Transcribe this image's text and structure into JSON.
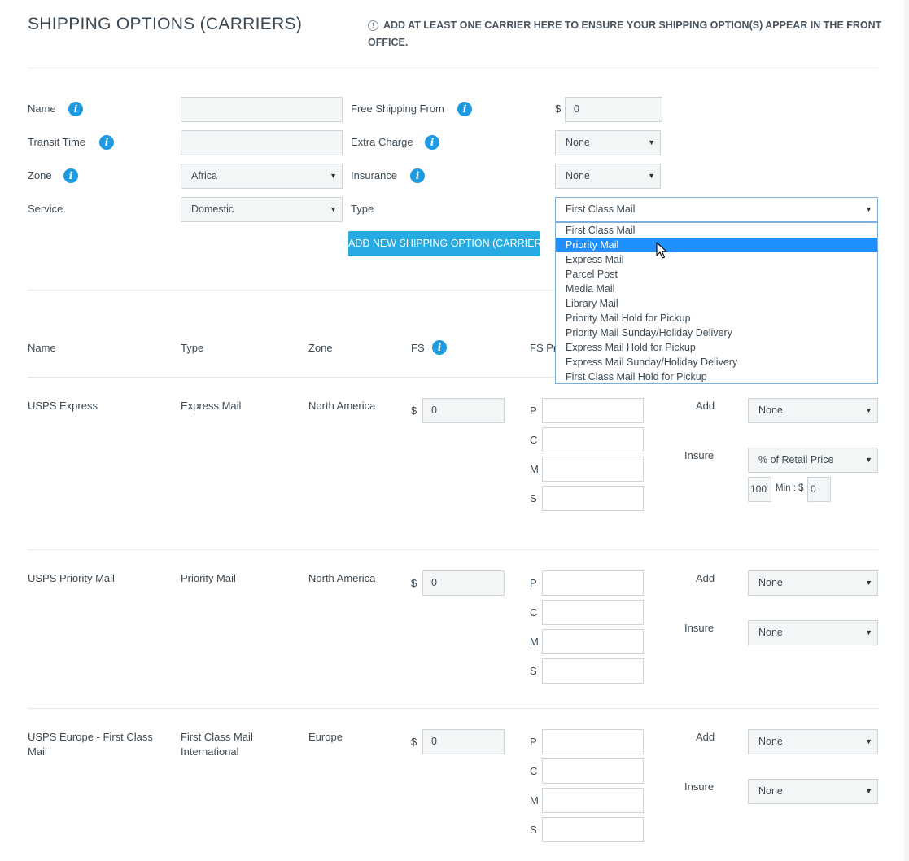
{
  "header": {
    "title": "SHIPPING OPTIONS (CARRIERS)",
    "notice_icon": "!",
    "notice": "ADD AT LEAST ONE CARRIER HERE TO ENSURE YOUR SHIPPING OPTION(S) APPEAR IN THE FRONT OFFICE."
  },
  "form": {
    "name_label": "Name",
    "transit_label": "Transit Time",
    "zone_label": "Zone",
    "zone_value": "Africa",
    "service_label": "Service",
    "service_value": "Domestic",
    "free_shipping_label": "Free Shipping From",
    "currency": "$",
    "free_shipping_value": "0",
    "extra_charge_label": "Extra Charge",
    "extra_charge_value": "None",
    "insurance_label": "Insurance",
    "insurance_value": "None",
    "type_label": "Type",
    "type_value": "First Class Mail",
    "add_button": "ADD NEW SHIPPING OPTION (CARRIER)",
    "info_glyph": "i",
    "arrow_glyph": "▼"
  },
  "type_dropdown": {
    "options": [
      "First Class Mail",
      "Priority Mail",
      "Express Mail",
      "Parcel Post",
      "Media Mail",
      "Library Mail",
      "Priority Mail Hold for Pickup",
      "Priority Mail Sunday/Holiday Delivery",
      "Express Mail Hold for Pickup",
      "Express Mail Sunday/Holiday Delivery",
      "First Class Mail Hold for Pickup"
    ],
    "highlighted": "Priority Mail"
  },
  "table": {
    "headers": {
      "name": "Name",
      "type": "Type",
      "zone": "Zone",
      "fs": "FS",
      "fs_price": "FS Pr"
    },
    "letters": {
      "p": "P",
      "c": "C",
      "m": "M",
      "s": "S"
    },
    "add_label": "Add",
    "insure_label": "Insure",
    "rows": [
      {
        "name": "USPS Express",
        "type": "Express Mail",
        "zone": "North America",
        "fs_value": "0",
        "add_value": "None",
        "insure_value": "% of Retail Price",
        "insure_percent": "100",
        "min_label": "Min : $",
        "min_value": "0"
      },
      {
        "name": "USPS Priority Mail",
        "type": "Priority Mail",
        "zone": "North America",
        "fs_value": "0",
        "add_value": "None",
        "insure_value": "None"
      },
      {
        "name": "USPS Europe - First Class Mail",
        "type": "First Class Mail International",
        "zone": "Europe",
        "fs_value": "0",
        "add_value": "None",
        "insure_value": "None"
      }
    ]
  }
}
